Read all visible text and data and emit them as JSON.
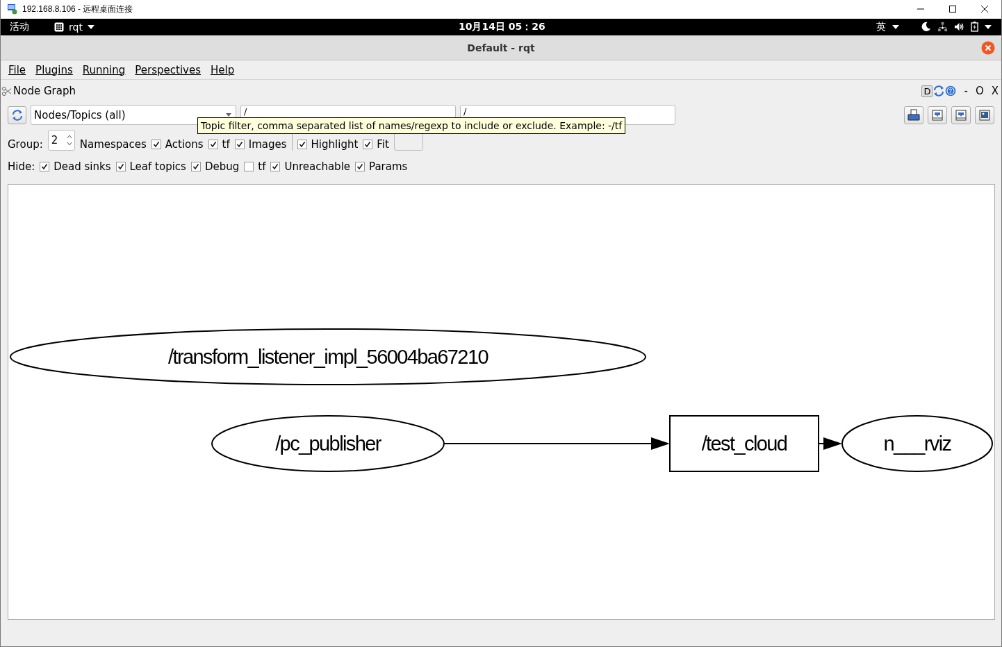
{
  "window": {
    "title": "192.168.8.106 - 远程桌面连接"
  },
  "top_bar": {
    "activities": "活动",
    "app_menu": "rqt",
    "clock": "10月14日 05：26",
    "input_method": "英"
  },
  "app_window": {
    "title": "Default - rqt"
  },
  "menu": [
    "File",
    "Plugins",
    "Running",
    "Perspectives",
    "Help"
  ],
  "plugin": {
    "title": "Node Graph",
    "buttons": [
      "D",
      "-",
      "O",
      "X"
    ]
  },
  "toolbar": {
    "mode": "Nodes/Topics (all)",
    "node_filter": "/",
    "topic_filter": "/"
  },
  "options": {
    "group_label": "Group:",
    "group_value": "2",
    "namespaces_label": "Namespaces",
    "checks": [
      {
        "label": "Actions",
        "checked": true
      },
      {
        "label": "tf",
        "checked": true
      },
      {
        "label": "Images",
        "checked": true
      }
    ],
    "view_checks": [
      {
        "label": "Highlight",
        "checked": true
      },
      {
        "label": "Fit",
        "checked": true
      }
    ]
  },
  "hide": {
    "label": "Hide:",
    "checks": [
      {
        "label": "Dead sinks",
        "checked": true
      },
      {
        "label": "Leaf topics",
        "checked": true
      },
      {
        "label": "Debug",
        "checked": true
      },
      {
        "label": "tf",
        "checked": false
      },
      {
        "label": "Unreachable",
        "checked": true
      },
      {
        "label": "Params",
        "checked": true
      }
    ]
  },
  "tooltip": "Topic filter, comma separated list of names/regexp to include or exclude. Example: -/tf",
  "graph": {
    "nodes": [
      {
        "label": "/transform_listener_impl_56004ba67210",
        "kind": "node"
      },
      {
        "label": "/pc_publisher",
        "kind": "node"
      },
      {
        "label": "/test_cloud",
        "kind": "topic"
      },
      {
        "label": "n___rviz",
        "kind": "node"
      }
    ]
  }
}
